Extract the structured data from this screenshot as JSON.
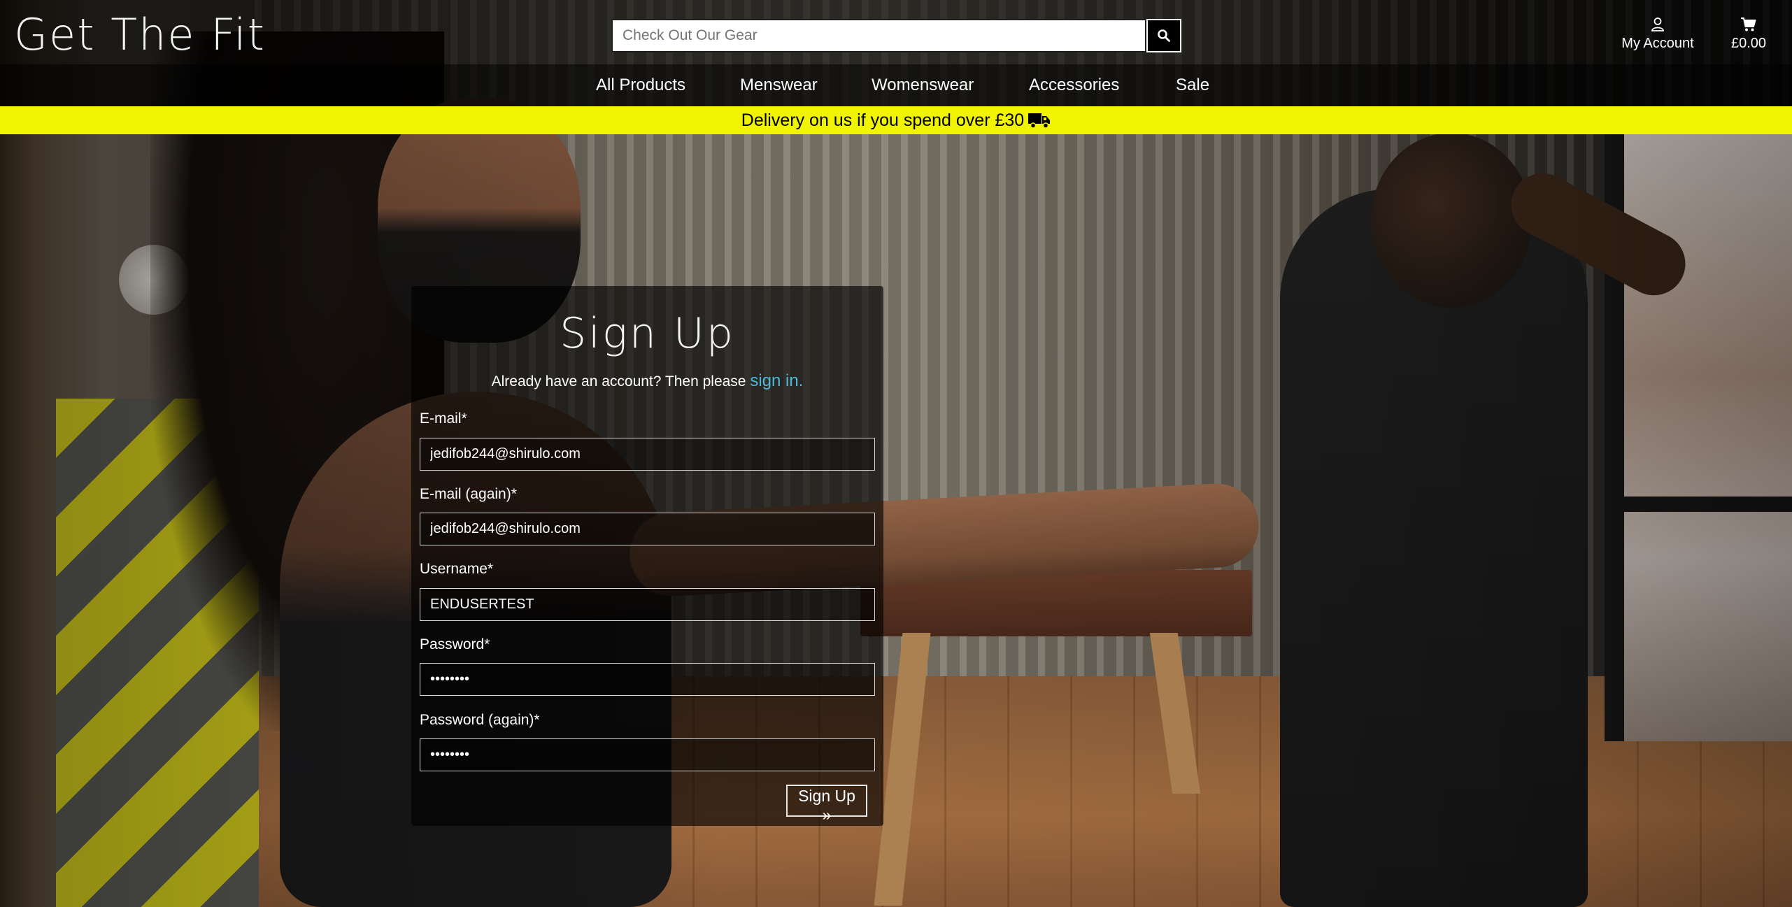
{
  "brand": {
    "name": "Get The Fit"
  },
  "search": {
    "placeholder": "Check Out Our Gear",
    "icon": "search-icon"
  },
  "account": {
    "label": "My Account",
    "icon": "user-icon"
  },
  "cart": {
    "total": "£0.00",
    "icon": "cart-icon"
  },
  "nav": {
    "items": [
      {
        "label": "All Products"
      },
      {
        "label": "Menswear"
      },
      {
        "label": "Womenswear"
      },
      {
        "label": "Accessories"
      },
      {
        "label": "Sale"
      }
    ]
  },
  "banner": {
    "text": "Delivery on us if you spend over £30",
    "icon": "truck-icon",
    "background_color": "#f1f400"
  },
  "signup": {
    "title": "Sign Up",
    "prompt": "Already have an account? Then please",
    "signin_link": "sign in.",
    "fields": [
      {
        "label": "E-mail*",
        "value": "jedifob244@shirulo.com",
        "type": "email"
      },
      {
        "label": "E-mail (again)*",
        "value": "jedifob244@shirulo.com",
        "type": "email"
      },
      {
        "label": "Username*",
        "value": "ENDUSERTEST",
        "type": "text"
      },
      {
        "label": "Password*",
        "value": "••••••••",
        "type": "password"
      },
      {
        "label": "Password (again)*",
        "value": "••••••••",
        "type": "password"
      }
    ],
    "submit_label": "Sign Up »"
  },
  "colors": {
    "link": "#4fb8d8",
    "banner": "#f1f400",
    "header_bg": "#000000"
  }
}
